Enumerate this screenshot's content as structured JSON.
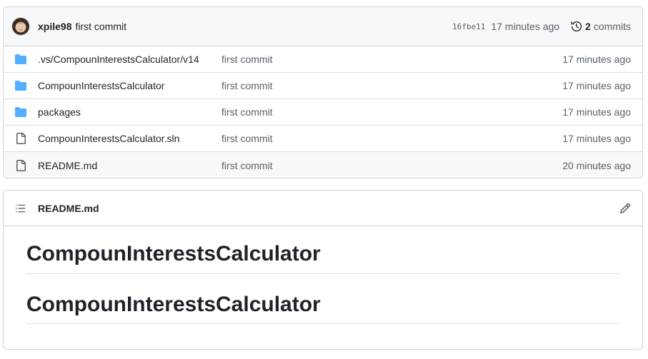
{
  "commit": {
    "author": "xpile98",
    "message": "first commit",
    "sha": "16fbe11",
    "time": "17 minutes ago",
    "count": "2",
    "count_label": "commits",
    "history_icon": "history-icon"
  },
  "files": [
    {
      "name": ".vs/CompounInterestsCalculator/v14",
      "type": "folder",
      "message": "first commit",
      "time": "17 minutes ago"
    },
    {
      "name": "CompounInterestsCalculator",
      "type": "folder",
      "message": "first commit",
      "time": "17 minutes ago"
    },
    {
      "name": "packages",
      "type": "folder",
      "message": "first commit",
      "time": "17 minutes ago"
    },
    {
      "name": "CompounInterestsCalculator.sln",
      "type": "file",
      "message": "first commit",
      "time": "17 minutes ago"
    },
    {
      "name": "README.md",
      "type": "file",
      "message": "first commit",
      "time": "20 minutes ago"
    }
  ],
  "readme": {
    "title": "README.md",
    "headings": [
      "CompounInterestsCalculator",
      "CompounInterestsCalculator"
    ]
  },
  "colors": {
    "folder": "#54aeff",
    "muted": "#57606a",
    "border": "#d0d7de"
  }
}
